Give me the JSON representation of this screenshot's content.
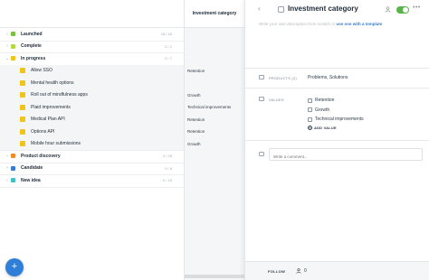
{
  "tree": {
    "rows": [
      {
        "label": "Launched",
        "count": "18 / 18",
        "color": "#7ac143",
        "expanded": false
      },
      {
        "label": "Complete",
        "count": "2 / 2",
        "color": "#b3d943",
        "expanded": false
      },
      {
        "label": "In progress",
        "count": "0 / 7",
        "color": "#f0c419",
        "expanded": true
      },
      {
        "label": "Allow SSO",
        "category": "Retention",
        "color": "#f0c419"
      },
      {
        "label": "Mental health options",
        "category": "",
        "color": "#f0c419"
      },
      {
        "label": "Roll out of mindfulness apps",
        "category": "Growth",
        "color": "#f0c419"
      },
      {
        "label": "Plaid improvements",
        "category": "Technical improvements",
        "color": "#f0c419"
      },
      {
        "label": "Medical Plan API",
        "category": "Retention",
        "color": "#f0c419"
      },
      {
        "label": "Options API",
        "category": "Retention",
        "color": "#f0c419"
      },
      {
        "label": "Mobile hour submissions",
        "category": "Growth",
        "color": "#f0c419"
      },
      {
        "label": "Product discovery",
        "count": "0 / 28",
        "color": "#f28c28",
        "expanded": false
      },
      {
        "label": "Candidate",
        "count": "0 / 8",
        "color": "#3a7bd5",
        "expanded": false
      },
      {
        "label": "New idea",
        "count": "0 / 15",
        "color": "#3fc1c9",
        "expanded": false
      }
    ],
    "chevron_collapsed": "›",
    "chevron_expanded": "⌄"
  },
  "column": {
    "header": "Investment category"
  },
  "detail": {
    "back_glyph": "‹",
    "title": "Investment category",
    "description_prefix": "Write your own description from scratch or",
    "description_link": "use one with a template",
    "more_glyph": "•••",
    "toggle_on": true,
    "products": {
      "label": "PRODUCTS (2)",
      "value": "Problems, Solutions"
    },
    "values": {
      "label": "VALUES",
      "items": [
        "Retention",
        "Growth",
        "Technical improvements"
      ],
      "add_label": "ADD VALUE",
      "add_glyph": "+"
    },
    "comment_placeholder": "Write a comment...",
    "footer": {
      "follow_label": "FOLLOW",
      "follow_count": "0"
    }
  },
  "fab": {
    "glyph": "+"
  },
  "colors": {
    "accent": "#2f7fd9",
    "toggle": "#58b34a"
  }
}
